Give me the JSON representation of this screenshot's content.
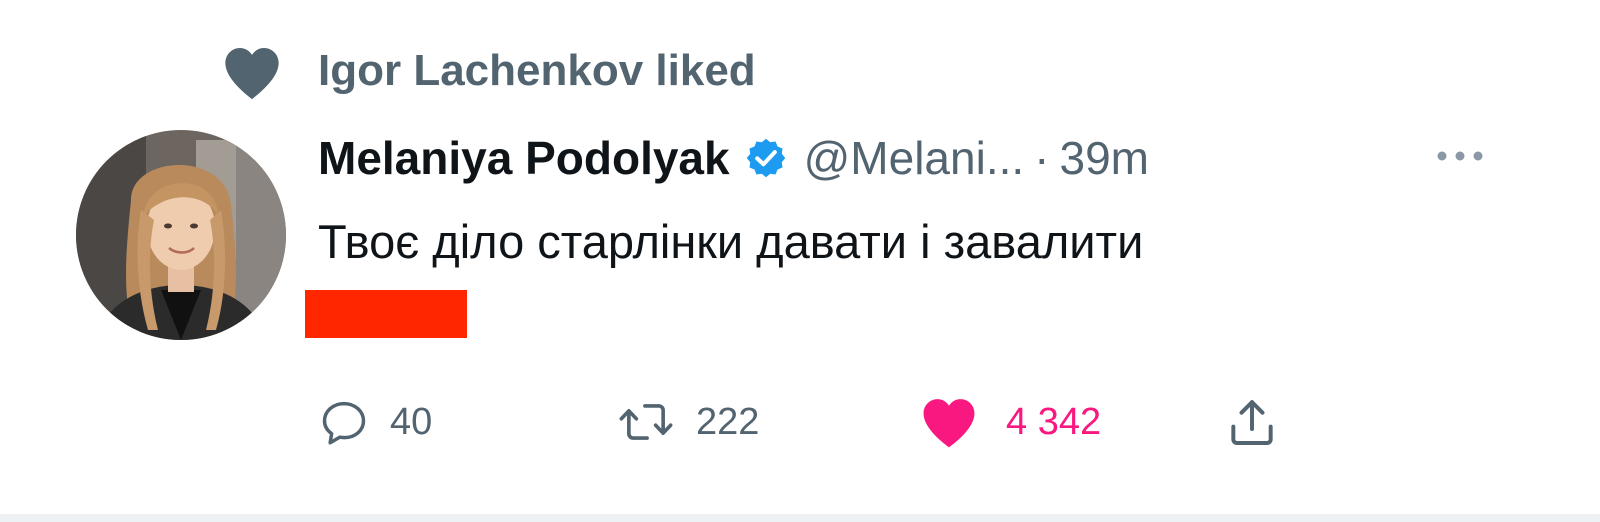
{
  "social_context": {
    "text": "Igor Lachenkov liked",
    "icon": "heart-icon"
  },
  "tweet": {
    "author": {
      "display_name": "Melaniya Podolyak",
      "handle": "@Melani...",
      "verified": true,
      "avatar": "avatar"
    },
    "separator": "·",
    "time": "39m",
    "text": "Твоє діло старлінки давати і завалити",
    "redacted": true
  },
  "actions": {
    "reply_count": "40",
    "retweet_count": "222",
    "like_count": "4 342",
    "liked": true
  },
  "colors": {
    "muted": "#536471",
    "text": "#0f1419",
    "like": "#f91880",
    "verified": "#1d9bf0",
    "redaction": "#ff2600"
  }
}
